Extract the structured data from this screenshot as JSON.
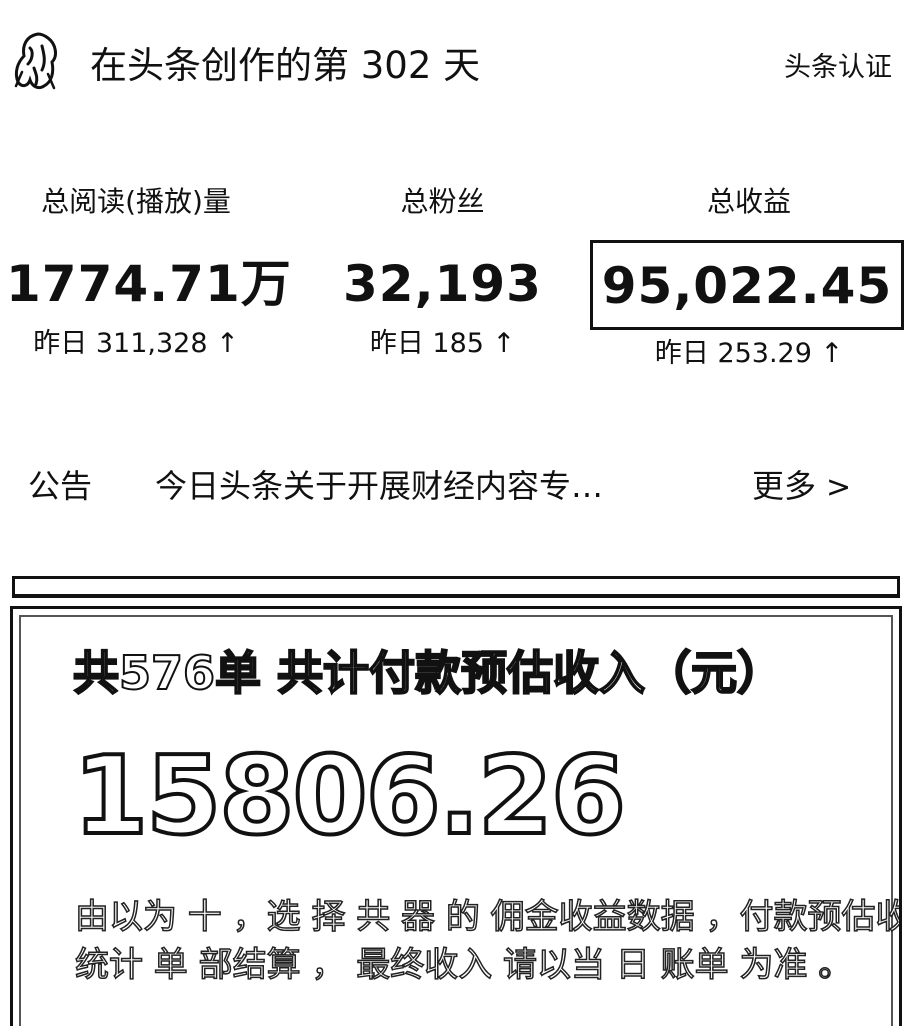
{
  "header": {
    "creation_title": "在头条创作的第 302 天",
    "cert_link": "头条认证"
  },
  "stats": [
    {
      "label": "总阅读(播放)量",
      "value": "1774.71万",
      "delta": "昨日 311,328 ↑"
    },
    {
      "label": "总粉丝",
      "value": "32,193",
      "delta": "昨日 185 ↑"
    },
    {
      "label": "总收益",
      "value": "95,022.45",
      "delta": "昨日 253.29 ↑"
    }
  ],
  "notice": {
    "label": "公告",
    "text": "今日头条关于开展财经内容专…",
    "more": "更多"
  },
  "income_card": {
    "title": "共576单 共计付款预估收入（元）",
    "amount": "15806.26",
    "desc_line1": "由以为 十 ，选 择 共 器 的 佣金收益数据 ，付款预估收入",
    "desc_line2": "统计 单  部结算 ， 最终收入 请以当 日 账单 为准 。"
  },
  "icons": {
    "avatar": "avatar-icon",
    "chevron": "chevron-right-icon",
    "arrow_up": "arrow-up-icon"
  }
}
